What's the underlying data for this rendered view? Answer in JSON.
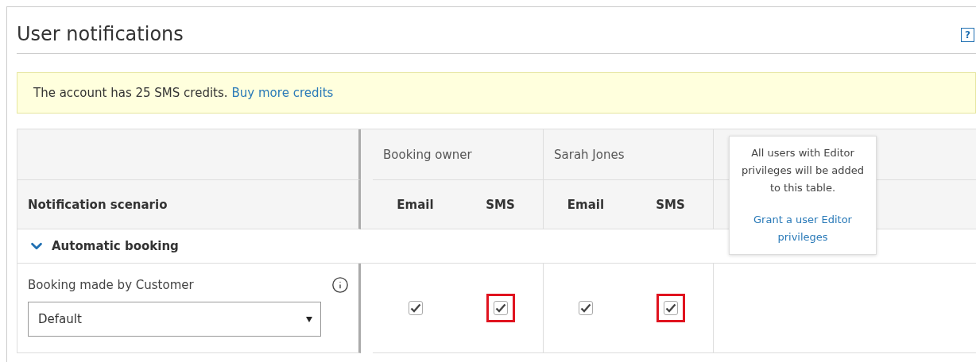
{
  "page": {
    "title": "User notifications",
    "help_button": "?"
  },
  "banner": {
    "text": "The account has 25 SMS credits.",
    "link": "Buy more credits"
  },
  "table": {
    "scenario_header": "Notification scenario",
    "users": [
      {
        "name": "Booking owner",
        "channels": [
          "Email",
          "SMS"
        ]
      },
      {
        "name": "Sarah Jones",
        "channels": [
          "Email",
          "SMS"
        ]
      }
    ],
    "groups": [
      {
        "label": "Automatic booking",
        "expanded": true,
        "rows": [
          {
            "label": "Booking made by Customer",
            "select_value": "Default",
            "checks": [
              [
                {
                  "checked": true,
                  "highlighted": false
                },
                {
                  "checked": true,
                  "highlighted": true
                }
              ],
              [
                {
                  "checked": true,
                  "highlighted": false
                },
                {
                  "checked": true,
                  "highlighted": true
                }
              ]
            ]
          }
        ]
      }
    ]
  },
  "tooltip": {
    "text": "All users with Editor privileges will be added to this table.",
    "link": "Grant a user Editor privileges"
  }
}
